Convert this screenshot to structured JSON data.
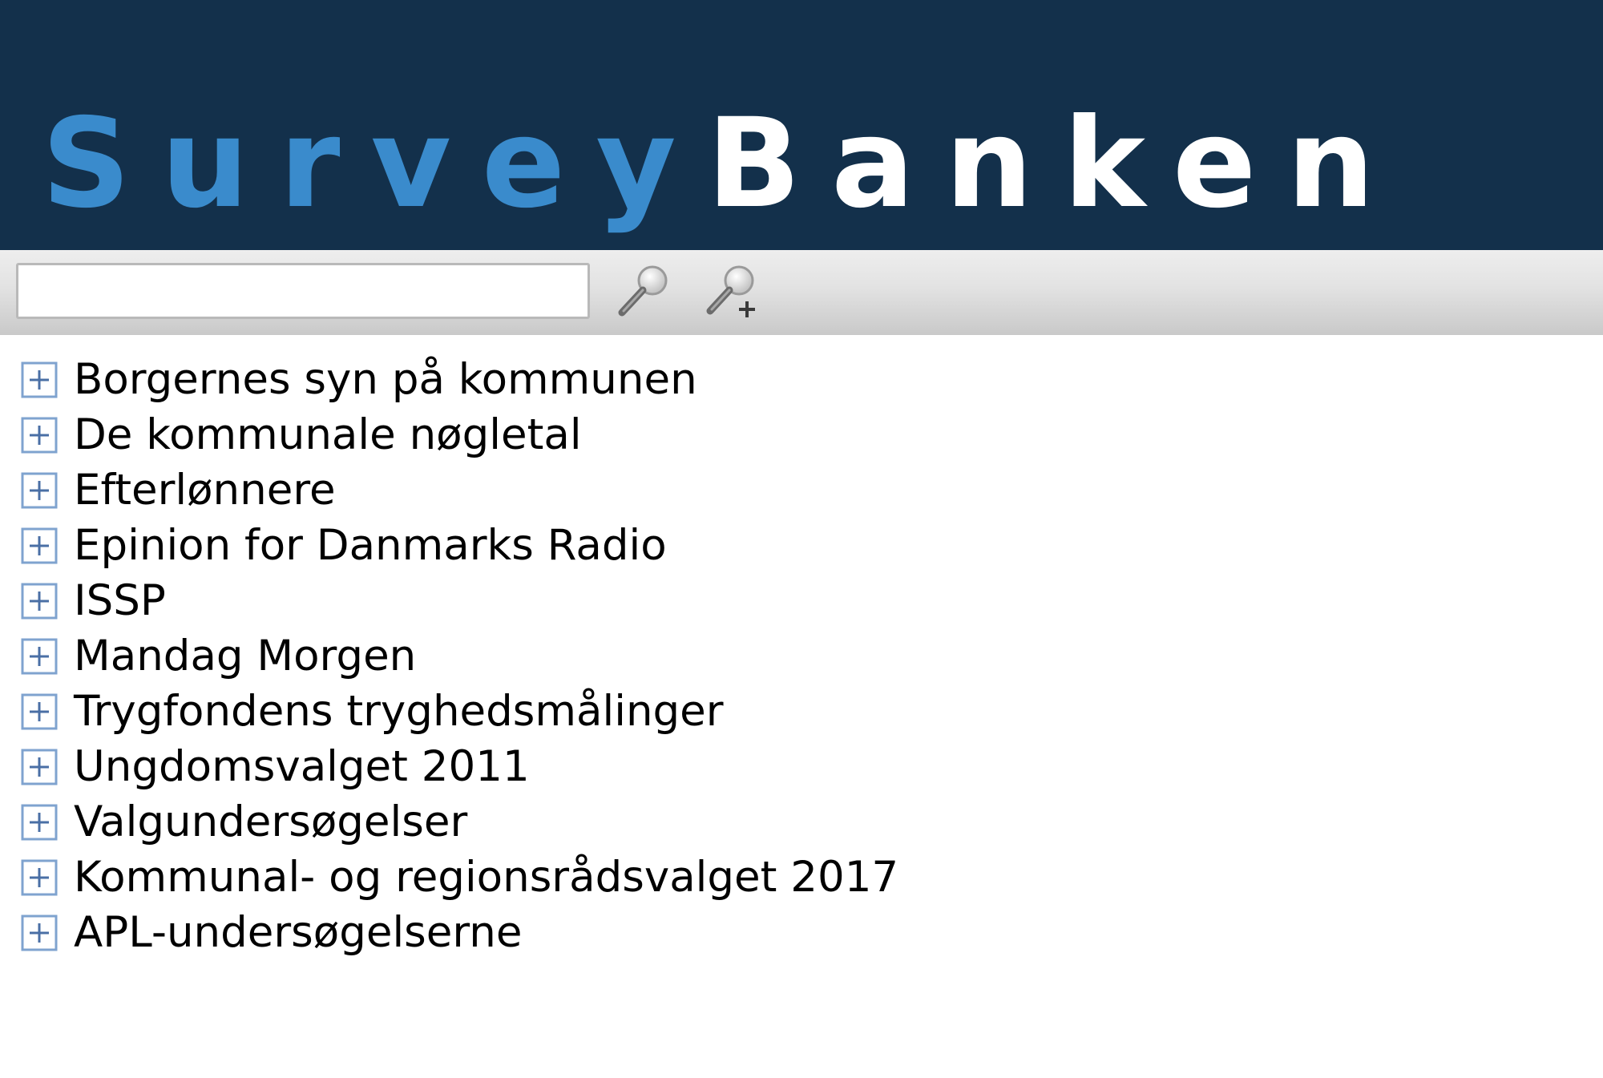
{
  "header": {
    "logo_survey": "Survey",
    "logo_banken": "Banken",
    "colors": {
      "background": "#13304b",
      "survey_text": "#3a8bcc",
      "banken_text": "#ffffff"
    }
  },
  "toolbar": {
    "search_value": "",
    "search_placeholder": "",
    "search_icon": "magnifier-icon",
    "advanced_search_icon": "magnifier-plus-icon"
  },
  "tree": {
    "expander_icon": "plus-box-icon",
    "items": [
      {
        "label": "Borgernes syn på kommunen"
      },
      {
        "label": "De kommunale nøgletal"
      },
      {
        "label": "Efterlønnere"
      },
      {
        "label": "Epinion for Danmarks Radio"
      },
      {
        "label": "ISSP"
      },
      {
        "label": "Mandag Morgen"
      },
      {
        "label": "Trygfondens tryghedsmålinger"
      },
      {
        "label": "Ungdomsvalget 2011"
      },
      {
        "label": "Valgundersøgelser"
      },
      {
        "label": "Kommunal- og regionsrådsvalget 2017"
      },
      {
        "label": "APL-undersøgelserne"
      }
    ]
  }
}
